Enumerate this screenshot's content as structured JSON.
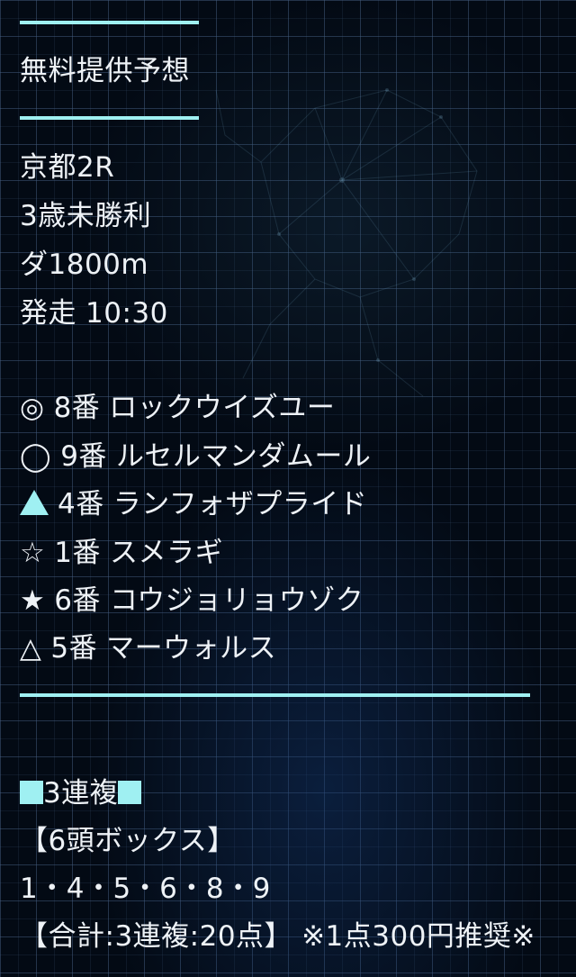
{
  "header": {
    "title": "無料提供予想"
  },
  "race": {
    "venue_race": "京都2R",
    "class": "3歳未勝利",
    "course": "ダ1800m",
    "start_label": "発走",
    "start_time": "10:30"
  },
  "picks": [
    {
      "mark": "◎",
      "number": "8番",
      "horse": "ロックウイズユー"
    },
    {
      "mark": "◯",
      "number": "9番",
      "horse": "ルセルマンダムール"
    },
    {
      "mark": "▲",
      "number": "4番",
      "horse": "ランフォザプライド"
    },
    {
      "mark": "☆",
      "number": "1番",
      "horse": "スメラギ"
    },
    {
      "mark": "★",
      "number": "6番",
      "horse": "コウジョリョウゾク"
    },
    {
      "mark": "△",
      "number": "5番",
      "horse": "マーウォルス"
    }
  ],
  "betting": {
    "bet_type": "3連複",
    "bet_type_marker_left": "■",
    "bet_type_marker_right": "■",
    "format": "【6頭ボックス】",
    "numbers": "1・4・5・6・8・9",
    "total": "【合計:3連複:20点】",
    "recommendation": "※1点300円推奨※"
  },
  "colors": {
    "accent": "#9ff0f2",
    "text": "#eef2f6",
    "background": "#030a14",
    "grid": "#465f82"
  }
}
